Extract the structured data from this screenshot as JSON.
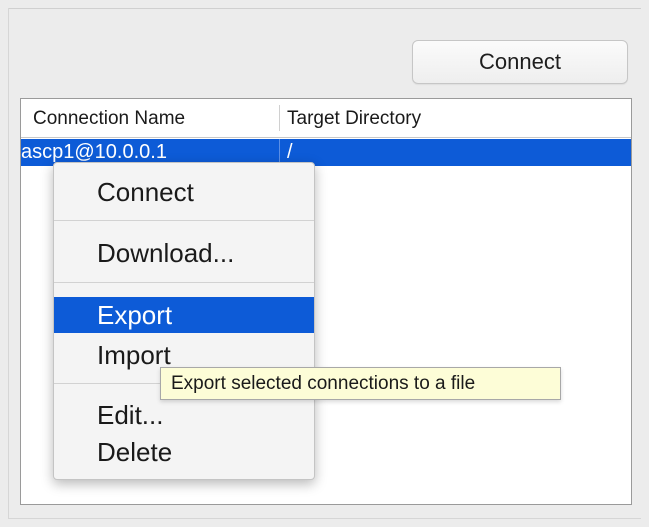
{
  "toolbar": {
    "connect_label": "Connect"
  },
  "table": {
    "columns": [
      "Connection Name",
      "Target Directory"
    ],
    "rows": [
      {
        "name": "ascp1@10.0.0.1",
        "target": "/",
        "selected": true
      }
    ]
  },
  "context_menu": {
    "items": [
      {
        "label": "Connect"
      },
      {
        "label": "Download..."
      },
      {
        "label": "Export",
        "highlighted": true
      },
      {
        "label": "Import"
      },
      {
        "label": "Edit..."
      },
      {
        "label": "Delete"
      }
    ]
  },
  "tooltip": {
    "text": "Export selected connections to a file"
  },
  "colors": {
    "selection": "#0d5bd7",
    "tooltip_bg": "#fdfdd7",
    "panel_bg": "#ececec"
  }
}
